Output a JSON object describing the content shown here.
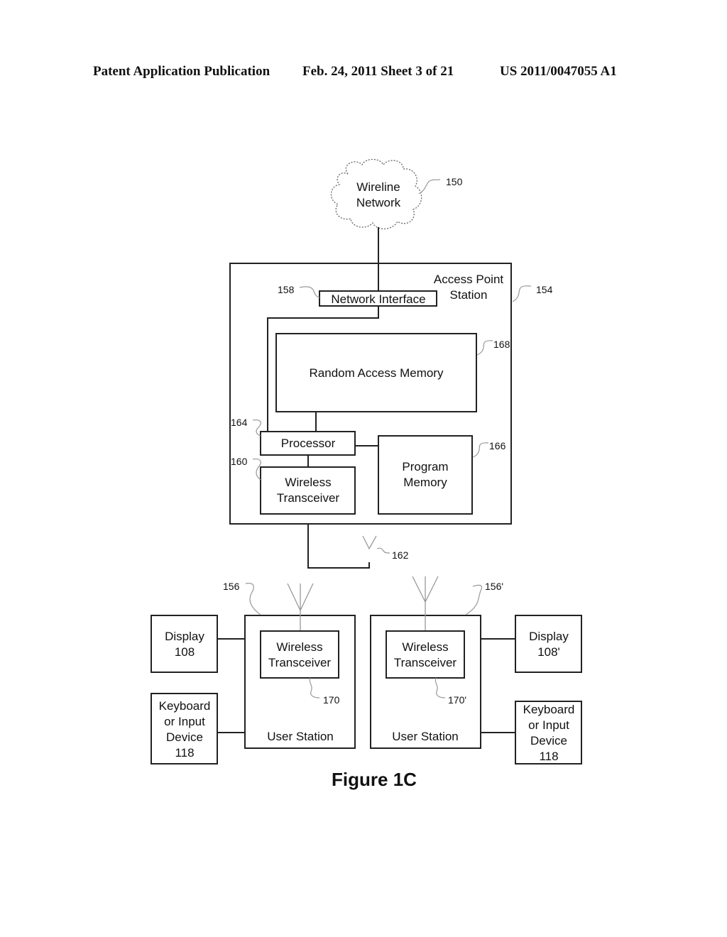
{
  "header": {
    "publication": "Patent Application Publication",
    "date_sheet": "Feb. 24, 2011   Sheet 3 of 21",
    "number": "US 2011/0047055 A1"
  },
  "diagram": {
    "cloud": {
      "line1": "Wireline",
      "line2": "Network",
      "ref": "150"
    },
    "access_point": {
      "line1": "Access Point",
      "line2": "Station",
      "ref": "154"
    },
    "network_interface": {
      "label": "Network Interface",
      "ref": "158"
    },
    "ram": {
      "label": "Random Access Memory",
      "ref": "168"
    },
    "processor": {
      "label": "Processor",
      "ref": "164"
    },
    "ap_transceiver": {
      "line1": "Wireless",
      "line2": "Transceiver",
      "ref": "160"
    },
    "program_memory": {
      "line1": "Program",
      "line2": "Memory",
      "ref": "166"
    },
    "ap_antenna": {
      "ref": "162"
    },
    "user_station_left": {
      "label": "User Station",
      "ref": "156",
      "transceiver": {
        "line1": "Wireless",
        "line2": "Transceiver",
        "ref": "170"
      },
      "display": {
        "line1": "Display",
        "line2": "108"
      },
      "keyboard": {
        "line1": "Keyboard",
        "line2": "or Input",
        "line3": "Device",
        "line4": "118"
      }
    },
    "user_station_right": {
      "label": "User Station",
      "ref": "156'",
      "transceiver": {
        "line1": "Wireless",
        "line2": "Transceiver",
        "ref": "170'"
      },
      "display": {
        "line1": "Display",
        "line2": "108'"
      },
      "keyboard": {
        "line1": "Keyboard",
        "line2": "or Input",
        "line3": "Device",
        "line4": "118"
      }
    },
    "caption": "Figure 1C"
  }
}
